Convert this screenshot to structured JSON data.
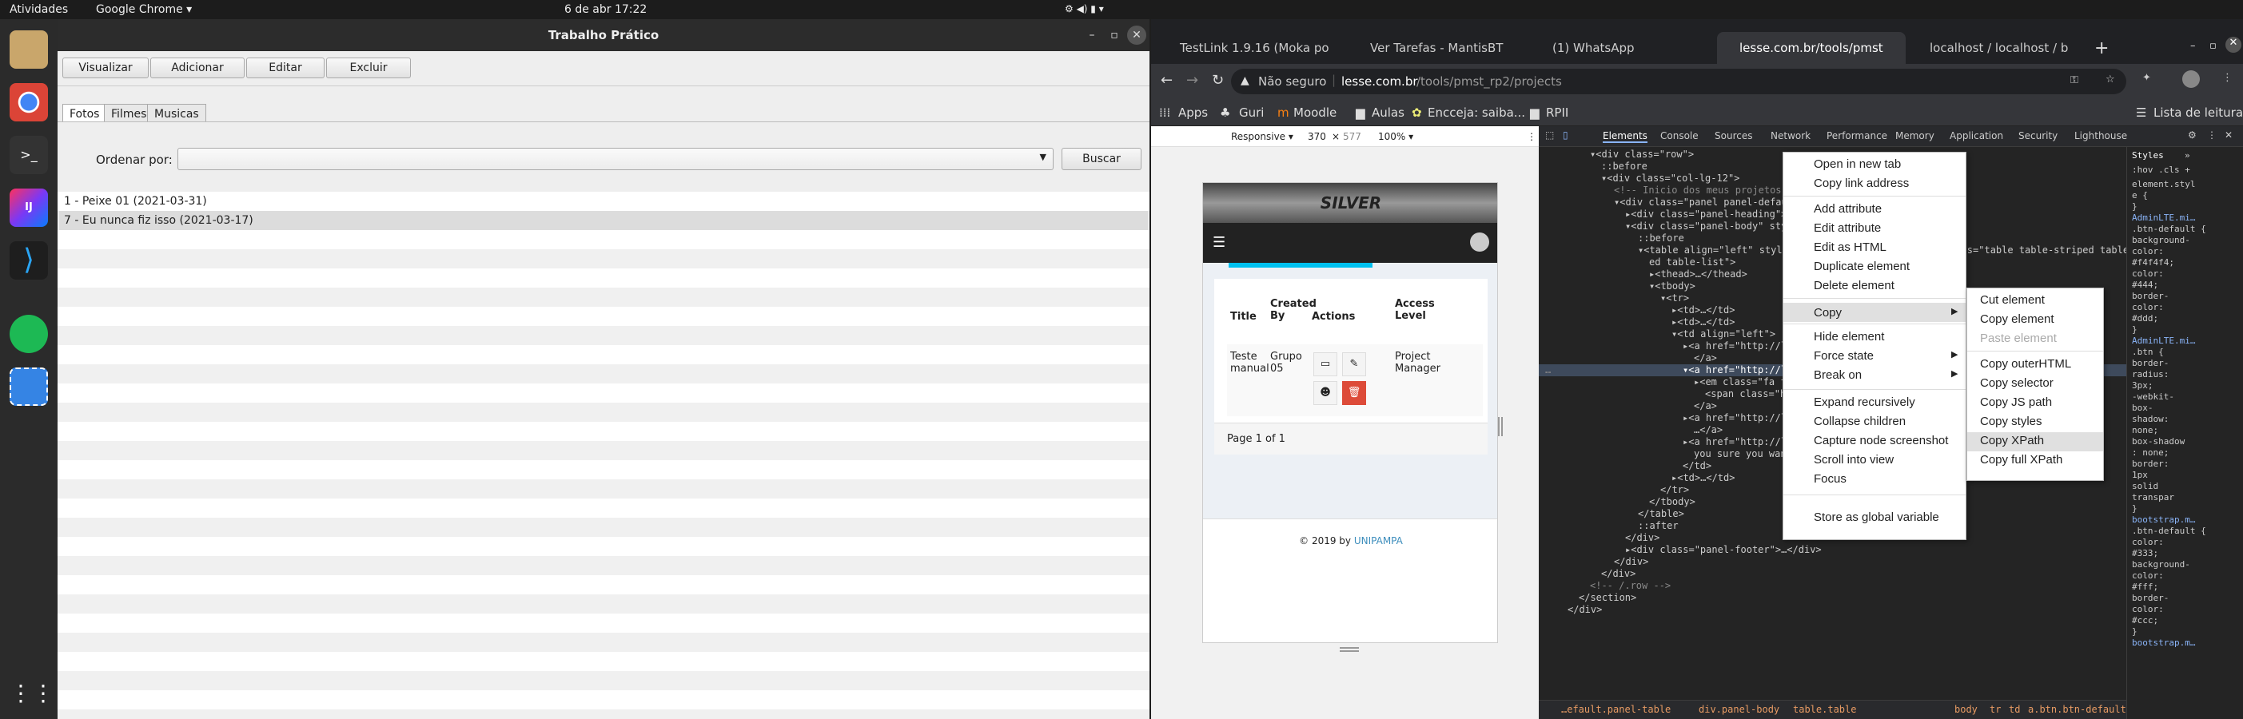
{
  "topbar": {
    "activities": "Atividades",
    "app": "Google Chrome ▾",
    "datetime": "6 de abr  17:22"
  },
  "dock": {
    "items": [
      "files",
      "chrome",
      "terminal",
      "intellij",
      "vscode",
      "spotify",
      "screenshot",
      "apps"
    ]
  },
  "left_app": {
    "title": "Trabalho Prático",
    "toolbar": [
      "Visualizar",
      "Adicionar",
      "Editar",
      "Excluir"
    ],
    "tabs": [
      "Fotos",
      "Filmes",
      "Musicas"
    ],
    "order_label": "Ordenar por:",
    "search_btn": "Buscar",
    "rows": [
      "1 - Peixe 01 (2021-03-31)",
      "7 - Eu nunca fiz isso (2021-03-17)"
    ]
  },
  "browser": {
    "tabs": [
      "TestLink 1.9.16 (Moka po",
      "Ver Tarefas - MantisBT",
      "(1) WhatsApp",
      "lesse.com.br/tools/pmst",
      "localhost / localhost / b"
    ],
    "address_insecure": "Não seguro",
    "address_host": "lesse.com.br",
    "address_path": "/tools/pmst_rp2/projects",
    "bookmarks": [
      "Apps",
      "Guri",
      "Moodle",
      "Aulas",
      "Encceja: saiba...",
      "RPII"
    ],
    "reading_list": "Lista de leitura",
    "device": {
      "mode": "Responsive ▾",
      "w": "370",
      "x": "×",
      "h": "577",
      "zoom": "100% ▾"
    },
    "page": {
      "logo": "SILVER",
      "table_headers": [
        "Title",
        "Created By",
        "Actions",
        "Access Level"
      ],
      "row": {
        "title": "Teste manual",
        "created": "Grupo 05",
        "access": "Project Manager"
      },
      "pagination": "Page 1 of 1",
      "footer_prefix": "© 2019 by ",
      "footer_link": "UNIPAMPA"
    }
  },
  "devtools": {
    "tabs": [
      "Elements",
      "Console",
      "Sources",
      "Network",
      "Performance",
      "Memory",
      "Application",
      "Security",
      "Lighthouse"
    ],
    "styles_tabs": [
      "Styles",
      "»"
    ],
    "styles_filter": ":hov  .cls  +",
    "styles_lines": [
      "element.styl",
      "e {",
      "}",
      "AdminLTE.mi…",
      ".btn-default {",
      "background-",
      "color:",
      "#f4f4f4;",
      "color:",
      "#444;",
      "border-",
      "color:",
      "#ddd;",
      "}",
      "AdminLTE.mi…",
      ".btn {",
      "border-",
      "radius:",
      "3px;",
      "-webkit-",
      "box-",
      "shadow:",
      "none;",
      "box-shadow",
      ": none;",
      "border:",
      "1px",
      "solid",
      "transpar",
      "}",
      "bootstrap.m…",
      ".btn-default {",
      "color:",
      "#333;",
      "background-",
      "color:",
      "#fff;",
      "border-",
      "color:",
      "#ccc;",
      "}",
      "bootstrap.m…"
    ],
    "dom_lines": [
      "▾<div class=\"row\">",
      "::before",
      "▾<div class=\"col-lg-12\">",
      "<!-- Inicio dos meus projetos -->",
      "▾<div class=\"panel panel-default panel-table\">",
      "▸<div class=\"panel-heading\">…</div>",
      "▾<div class=\"panel-body\" style=\"background-color: #fff\">",
      "::before",
      "▾<table align=\"left\" style=\"word-break: break-word;\" class=\"table table-striped table-border",
      "ed table-list\">",
      "▸<thead>…</thead>",
      "▾<tbody>",
      "▾<tr>",
      "▸<td>…</td>",
      "▸<td>…</td>",
      "▾<td align=\"left\">",
      "▸<a href=\"http://le                          2\" class=\"btn btn-default\">…",
      "</a>",
      "▾<a href=\"http://le                      class=\"btn btn-default\"> == $0",
      "▸<em class=\"fa fa",
      "<span class=\"hid",
      "</a>",
      "▸<a href=\"http://le                          /42\" class=\"btn btn-default\">",
      "…</a>",
      "▸<a href=\"http://le                                                     'Are",
      "you sure you want to",
      "</td>",
      "▸<td>…</td>",
      "</tr>",
      "</tbody>",
      "</table>",
      "::after",
      "</div>",
      "▸<div class=\"panel-footer\">…</div>",
      "</div>",
      "</div>",
      "<!-- /.row -->",
      "</section>",
      "</div>"
    ],
    "breadcrumb": [
      "…efault.panel-table",
      "div.panel-body",
      "table.table",
      "body",
      "tr",
      "td",
      "a.btn.btn-default."
    ]
  },
  "context_menu": {
    "items": [
      "Open in new tab",
      "Copy link address",
      "Add attribute",
      "Edit attribute",
      "Edit as HTML",
      "Duplicate element",
      "Delete element",
      "Copy",
      "Hide element",
      "Force state",
      "Break on",
      "Expand recursively",
      "Collapse children",
      "Capture node screenshot",
      "Scroll into view",
      "Focus",
      "Store as global variable"
    ],
    "submenu": [
      "Cut element",
      "Copy element",
      "Paste element",
      "Copy outerHTML",
      "Copy selector",
      "Copy JS path",
      "Copy styles",
      "Copy XPath",
      "Copy full XPath"
    ]
  }
}
